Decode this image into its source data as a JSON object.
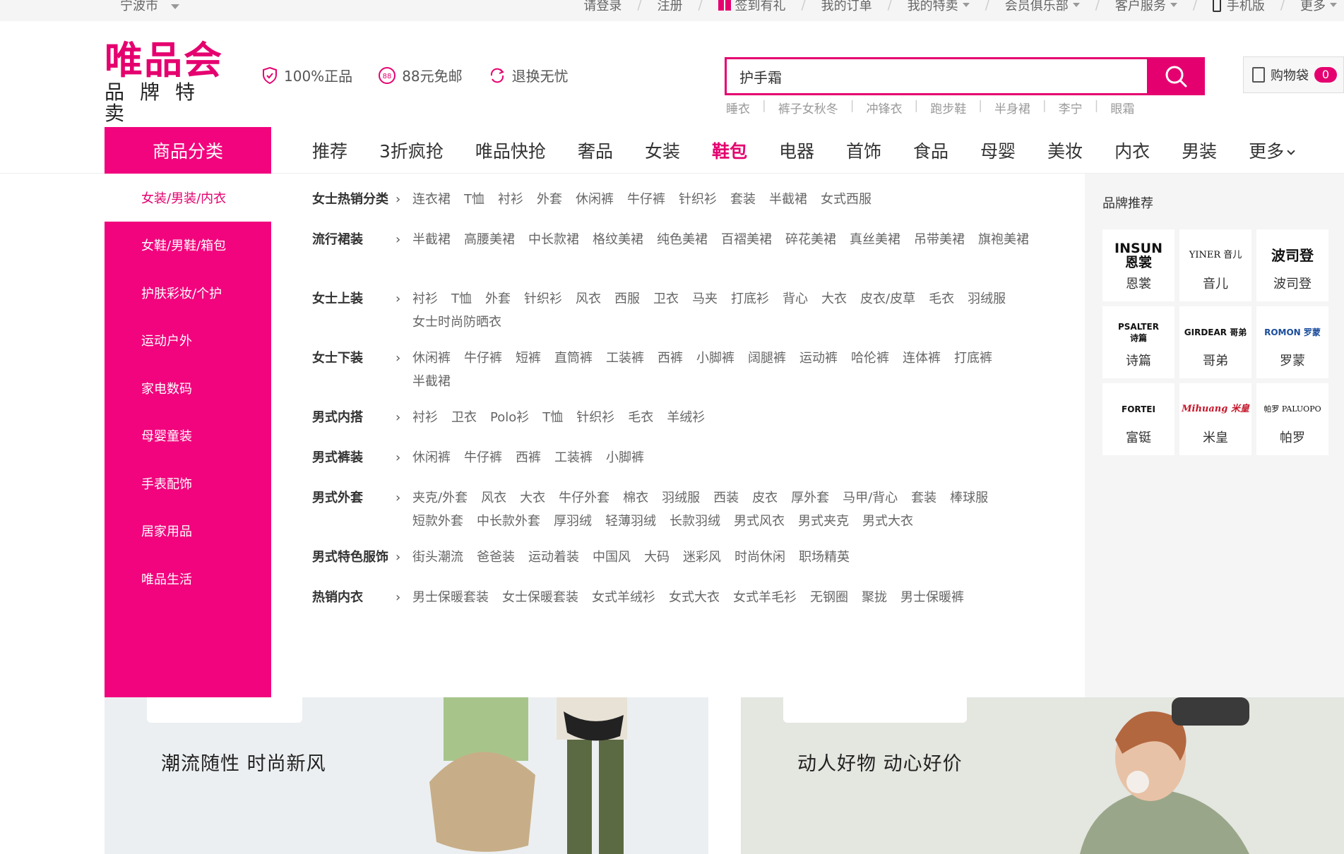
{
  "topbar": {
    "city": "宁波市",
    "links": [
      "请登录",
      "注册",
      "签到有礼",
      "我的订单",
      "我的特卖",
      "会员俱乐部",
      "客户服务",
      "手机版",
      "更多"
    ]
  },
  "header": {
    "logo_main": "唯品会",
    "logo_sub": "品牌特卖",
    "promises": [
      "100%正品",
      "88元免邮",
      "退换无忧"
    ],
    "search_value": "护手霜",
    "hotwords": [
      "睡衣",
      "裤子女秋冬",
      "冲锋衣",
      "跑步鞋",
      "半身裙",
      "李宁",
      "眼霜"
    ],
    "cart_label": "购物袋",
    "cart_count": "0"
  },
  "nav": {
    "category_label": "商品分类",
    "items": [
      "推荐",
      "3折疯抢",
      "唯品快抢",
      "奢品",
      "女装",
      "鞋包",
      "电器",
      "首饰",
      "食品",
      "母婴",
      "美妆",
      "内衣",
      "男装",
      "更多"
    ]
  },
  "sidebar": {
    "items": [
      "女装/男装/内衣",
      "女鞋/男鞋/箱包",
      "护肤彩妆/个护",
      "运动户外",
      "家电数码",
      "母婴童装",
      "手表配饰",
      "居家用品",
      "唯品生活"
    ]
  },
  "subcats": [
    {
      "name": "女士热销分类",
      "links": [
        "连衣裙",
        "T恤",
        "衬衫",
        "外套",
        "休闲裤",
        "牛仔裤",
        "针织衫",
        "套装",
        "半截裙",
        "女式西服"
      ]
    },
    {
      "name": "流行裙装",
      "links": [
        "半截裙",
        "高腰美裙",
        "中长款裙",
        "格纹美裙",
        "纯色美裙",
        "百褶美裙",
        "碎花美裙",
        "真丝美裙",
        "吊带美裙",
        "旗袍美裙"
      ]
    },
    {
      "name": "女士上装",
      "links": [
        "衬衫",
        "T恤",
        "外套",
        "针织衫",
        "风衣",
        "西服",
        "卫衣",
        "马夹",
        "打底衫",
        "背心",
        "大衣",
        "皮衣/皮草",
        "毛衣",
        "羽绒服",
        "女士时尚防晒衣"
      ]
    },
    {
      "name": "女士下装",
      "links": [
        "休闲裤",
        "牛仔裤",
        "短裤",
        "直筒裤",
        "工装裤",
        "西裤",
        "小脚裤",
        "阔腿裤",
        "运动裤",
        "哈伦裤",
        "连体裤",
        "打底裤",
        "半截裙"
      ]
    },
    {
      "name": "男式内搭",
      "links": [
        "衬衫",
        "卫衣",
        "Polo衫",
        "T恤",
        "针织衫",
        "毛衣",
        "羊绒衫"
      ]
    },
    {
      "name": "男式裤装",
      "links": [
        "休闲裤",
        "牛仔裤",
        "西裤",
        "工装裤",
        "小脚裤"
      ]
    },
    {
      "name": "男式外套",
      "links": [
        "夹克/外套",
        "风衣",
        "大衣",
        "牛仔外套",
        "棉衣",
        "羽绒服",
        "西装",
        "皮衣",
        "厚外套",
        "马甲/背心",
        "套装",
        "棒球服",
        "短款外套",
        "中长款外套",
        "厚羽绒",
        "轻薄羽绒",
        "长款羽绒",
        "男式风衣",
        "男式夹克",
        "男式大衣"
      ]
    },
    {
      "name": "男式特色服饰",
      "links": [
        "街头潮流",
        "爸爸装",
        "运动着装",
        "中国风",
        "大码",
        "迷彩风",
        "时尚休闲",
        "职场精英"
      ]
    },
    {
      "name": "热销内衣",
      "links": [
        "男士保暖套装",
        "女士保暖套装",
        "女式羊绒衫",
        "女式大衣",
        "女式羊毛衫",
        "无钢圈",
        "聚拢",
        "男士保暖裤"
      ]
    }
  ],
  "brands": {
    "title": "品牌推荐",
    "items": [
      {
        "logo": "INSUN\n恩裳",
        "name": "恩裳"
      },
      {
        "logo": "YINER 音儿",
        "name": "音儿"
      },
      {
        "logo": "波司登",
        "name": "波司登"
      },
      {
        "logo": "PSALTER\n诗篇",
        "name": "诗篇"
      },
      {
        "logo": "GIRDEAR 哥弟",
        "name": "哥弟"
      },
      {
        "logo": "ROMON 罗蒙",
        "name": "罗蒙"
      },
      {
        "logo": "FORTEI",
        "name": "富铤"
      },
      {
        "logo": "Mihuang 米皇",
        "name": "米皇"
      },
      {
        "logo": "帕罗 PALUOPO",
        "name": "帕罗"
      }
    ]
  },
  "banners": {
    "left_slogan": "潮流随性 时尚新风",
    "right_slogan": "动人好物 动心好价"
  },
  "colors": {
    "brand": "#e5006f",
    "sidebar": "#f1047d"
  }
}
